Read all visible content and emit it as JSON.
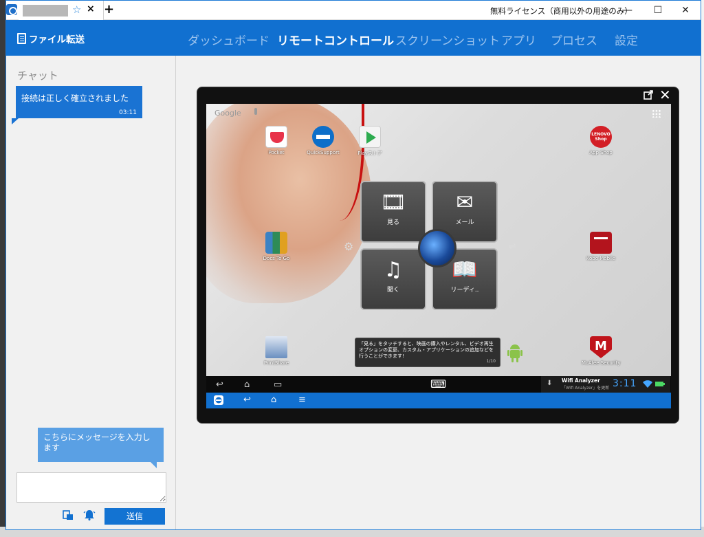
{
  "window": {
    "license_text": "無料ライセンス（商用以外の用途のみ）",
    "new_tab_symbol": "+",
    "tab_close_symbol": "×",
    "tab_star_symbol": "☆",
    "minimize_symbol": "—",
    "maximize_symbol": "☐",
    "close_symbol": "✕"
  },
  "nav": {
    "file_transfer": "ファイル転送",
    "items": [
      {
        "label": "ダッシュボード",
        "active": false
      },
      {
        "label": "リモートコントロール",
        "active": true
      },
      {
        "label": "スクリーンショット",
        "active": false
      },
      {
        "label": "アプリ",
        "active": false
      },
      {
        "label": "プロセス",
        "active": false
      },
      {
        "label": "設定",
        "active": false
      }
    ]
  },
  "chat": {
    "title": "チャット",
    "messages": [
      {
        "text": "接続は正しく確立されました",
        "time": "03:11"
      }
    ],
    "input_prompt": "こちらにメッセージを入力します",
    "send_label": "送信"
  },
  "device": {
    "google_label": "Google",
    "apps": [
      {
        "label": "Pocket",
        "icon": "pocket-icon",
        "color": "#e8334a"
      },
      {
        "label": "QuickSupport",
        "icon": "teamviewer-icon",
        "color": "#0e6fc9"
      },
      {
        "label": "Playストア",
        "icon": "play-store-icon",
        "color": "#ffffff"
      },
      {
        "label": "App Shop",
        "icon": "lenovo-shop-icon",
        "color": "#d31f26"
      },
      {
        "label": "Docs To Go",
        "icon": "docs-to-go-icon",
        "color": "#2e8b57"
      },
      {
        "label": "Kobo Mobile",
        "icon": "kobo-icon",
        "color": "#b3141d"
      },
      {
        "label": "PrintShare",
        "icon": "print-icon",
        "color": "#6a8fc0"
      },
      {
        "label": "McAfee Security",
        "icon": "mcafee-icon",
        "color": "#c0141b"
      }
    ],
    "lenovo_badge": "LENOVO Shop",
    "hub_tiles": [
      {
        "label": "見る",
        "icon": "film-icon",
        "glyph": "🎞"
      },
      {
        "label": "メール",
        "icon": "mail-icon",
        "glyph": "✉"
      },
      {
        "label": "聞く",
        "icon": "music-icon",
        "glyph": "♫"
      },
      {
        "label": "リーディ..",
        "icon": "book-icon",
        "glyph": "📖"
      }
    ],
    "hub_settings_glyph": "⚙",
    "hub_eq_glyph": "⇌",
    "tooltip_text": "「見る」をタッチすると、映画の購入やレンタル、ビデオ再生オプションの変更、カスタム・アプリケーションの追加などを行うことができます!",
    "tooltip_page": "1/10",
    "nav_back": "↩",
    "nav_home": "⌂",
    "nav_recent": "▭",
    "keyboard_glyph": "⌨",
    "notification_title": "Wifi Analyzer",
    "notification_sub": "「Wifi Analyzer」を更新",
    "download_glyph": "⬇",
    "clock": "3:11",
    "tv_back": "↩",
    "tv_home": "⌂",
    "tv_menu": "≡",
    "accent_blue": "#1170d0"
  }
}
